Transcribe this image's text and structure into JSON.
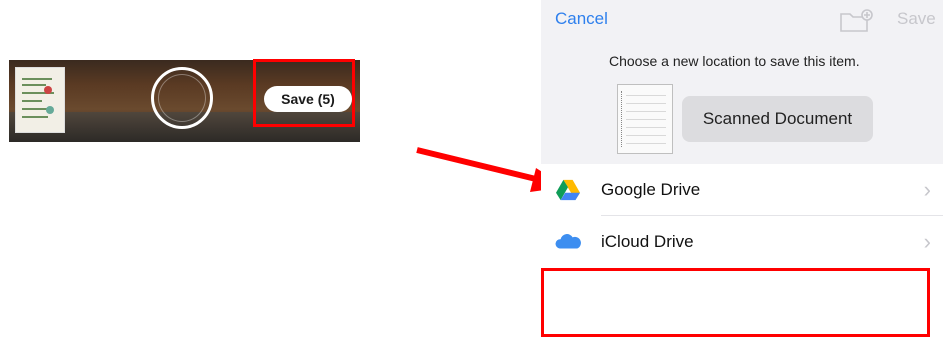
{
  "camera": {
    "save_button_label": "Save (5)"
  },
  "sheet": {
    "cancel_label": "Cancel",
    "save_label": "Save",
    "message": "Choose a new location to save this item.",
    "document_name": "Scanned Document",
    "locations": [
      {
        "label": "Google Drive",
        "icon": "google-drive-icon"
      },
      {
        "label": "iCloud Drive",
        "icon": "icloud-icon"
      }
    ]
  },
  "colors": {
    "highlight": "#ff0000",
    "ios_blue": "#2f80ed",
    "disabled_gray": "#c7c7cc"
  }
}
